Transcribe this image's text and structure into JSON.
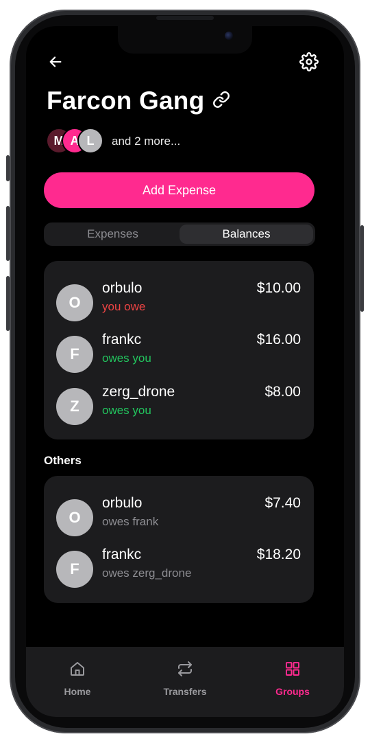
{
  "header": {
    "title": "Farcon Gang",
    "back_icon": "arrow-left-icon",
    "settings_icon": "gear-icon",
    "link_icon": "link-icon"
  },
  "members": {
    "avatars": [
      {
        "initial": "M",
        "color": "#5a1a2c"
      },
      {
        "initial": "A",
        "color": "#ff2a8f"
      },
      {
        "initial": "L",
        "color": "#b7b7ba"
      }
    ],
    "more_text": "and 2 more..."
  },
  "actions": {
    "add_expense": "Add Expense"
  },
  "segment": {
    "tabs": [
      "Expenses",
      "Balances"
    ],
    "selected": "Balances"
  },
  "balances": [
    {
      "initial": "O",
      "name": "orbulo",
      "status": "you owe",
      "status_color": "#ef4444",
      "amount": "$10.00"
    },
    {
      "initial": "F",
      "name": "frankc",
      "status": "owes you",
      "status_color": "#22c55e",
      "amount": "$16.00"
    },
    {
      "initial": "Z",
      "name": "zerg_drone",
      "status": "owes you",
      "status_color": "#22c55e",
      "amount": "$8.00"
    }
  ],
  "others_label": "Others",
  "others": [
    {
      "initial": "O",
      "name": "orbulo",
      "status": "owes frank",
      "status_color": "#8d8d92",
      "amount": "$7.40"
    },
    {
      "initial": "F",
      "name": "frankc",
      "status": "owes zerg_drone",
      "status_color": "#8d8d92",
      "amount": "$18.20"
    }
  ],
  "tabbar": {
    "items": [
      {
        "label": "Home",
        "icon": "home-icon",
        "active": false
      },
      {
        "label": "Transfers",
        "icon": "transfer-icon",
        "active": false
      },
      {
        "label": "Groups",
        "icon": "grid-icon",
        "active": true
      }
    ],
    "active_color": "#ff2a8f",
    "inactive_color": "#9a9a9e"
  }
}
